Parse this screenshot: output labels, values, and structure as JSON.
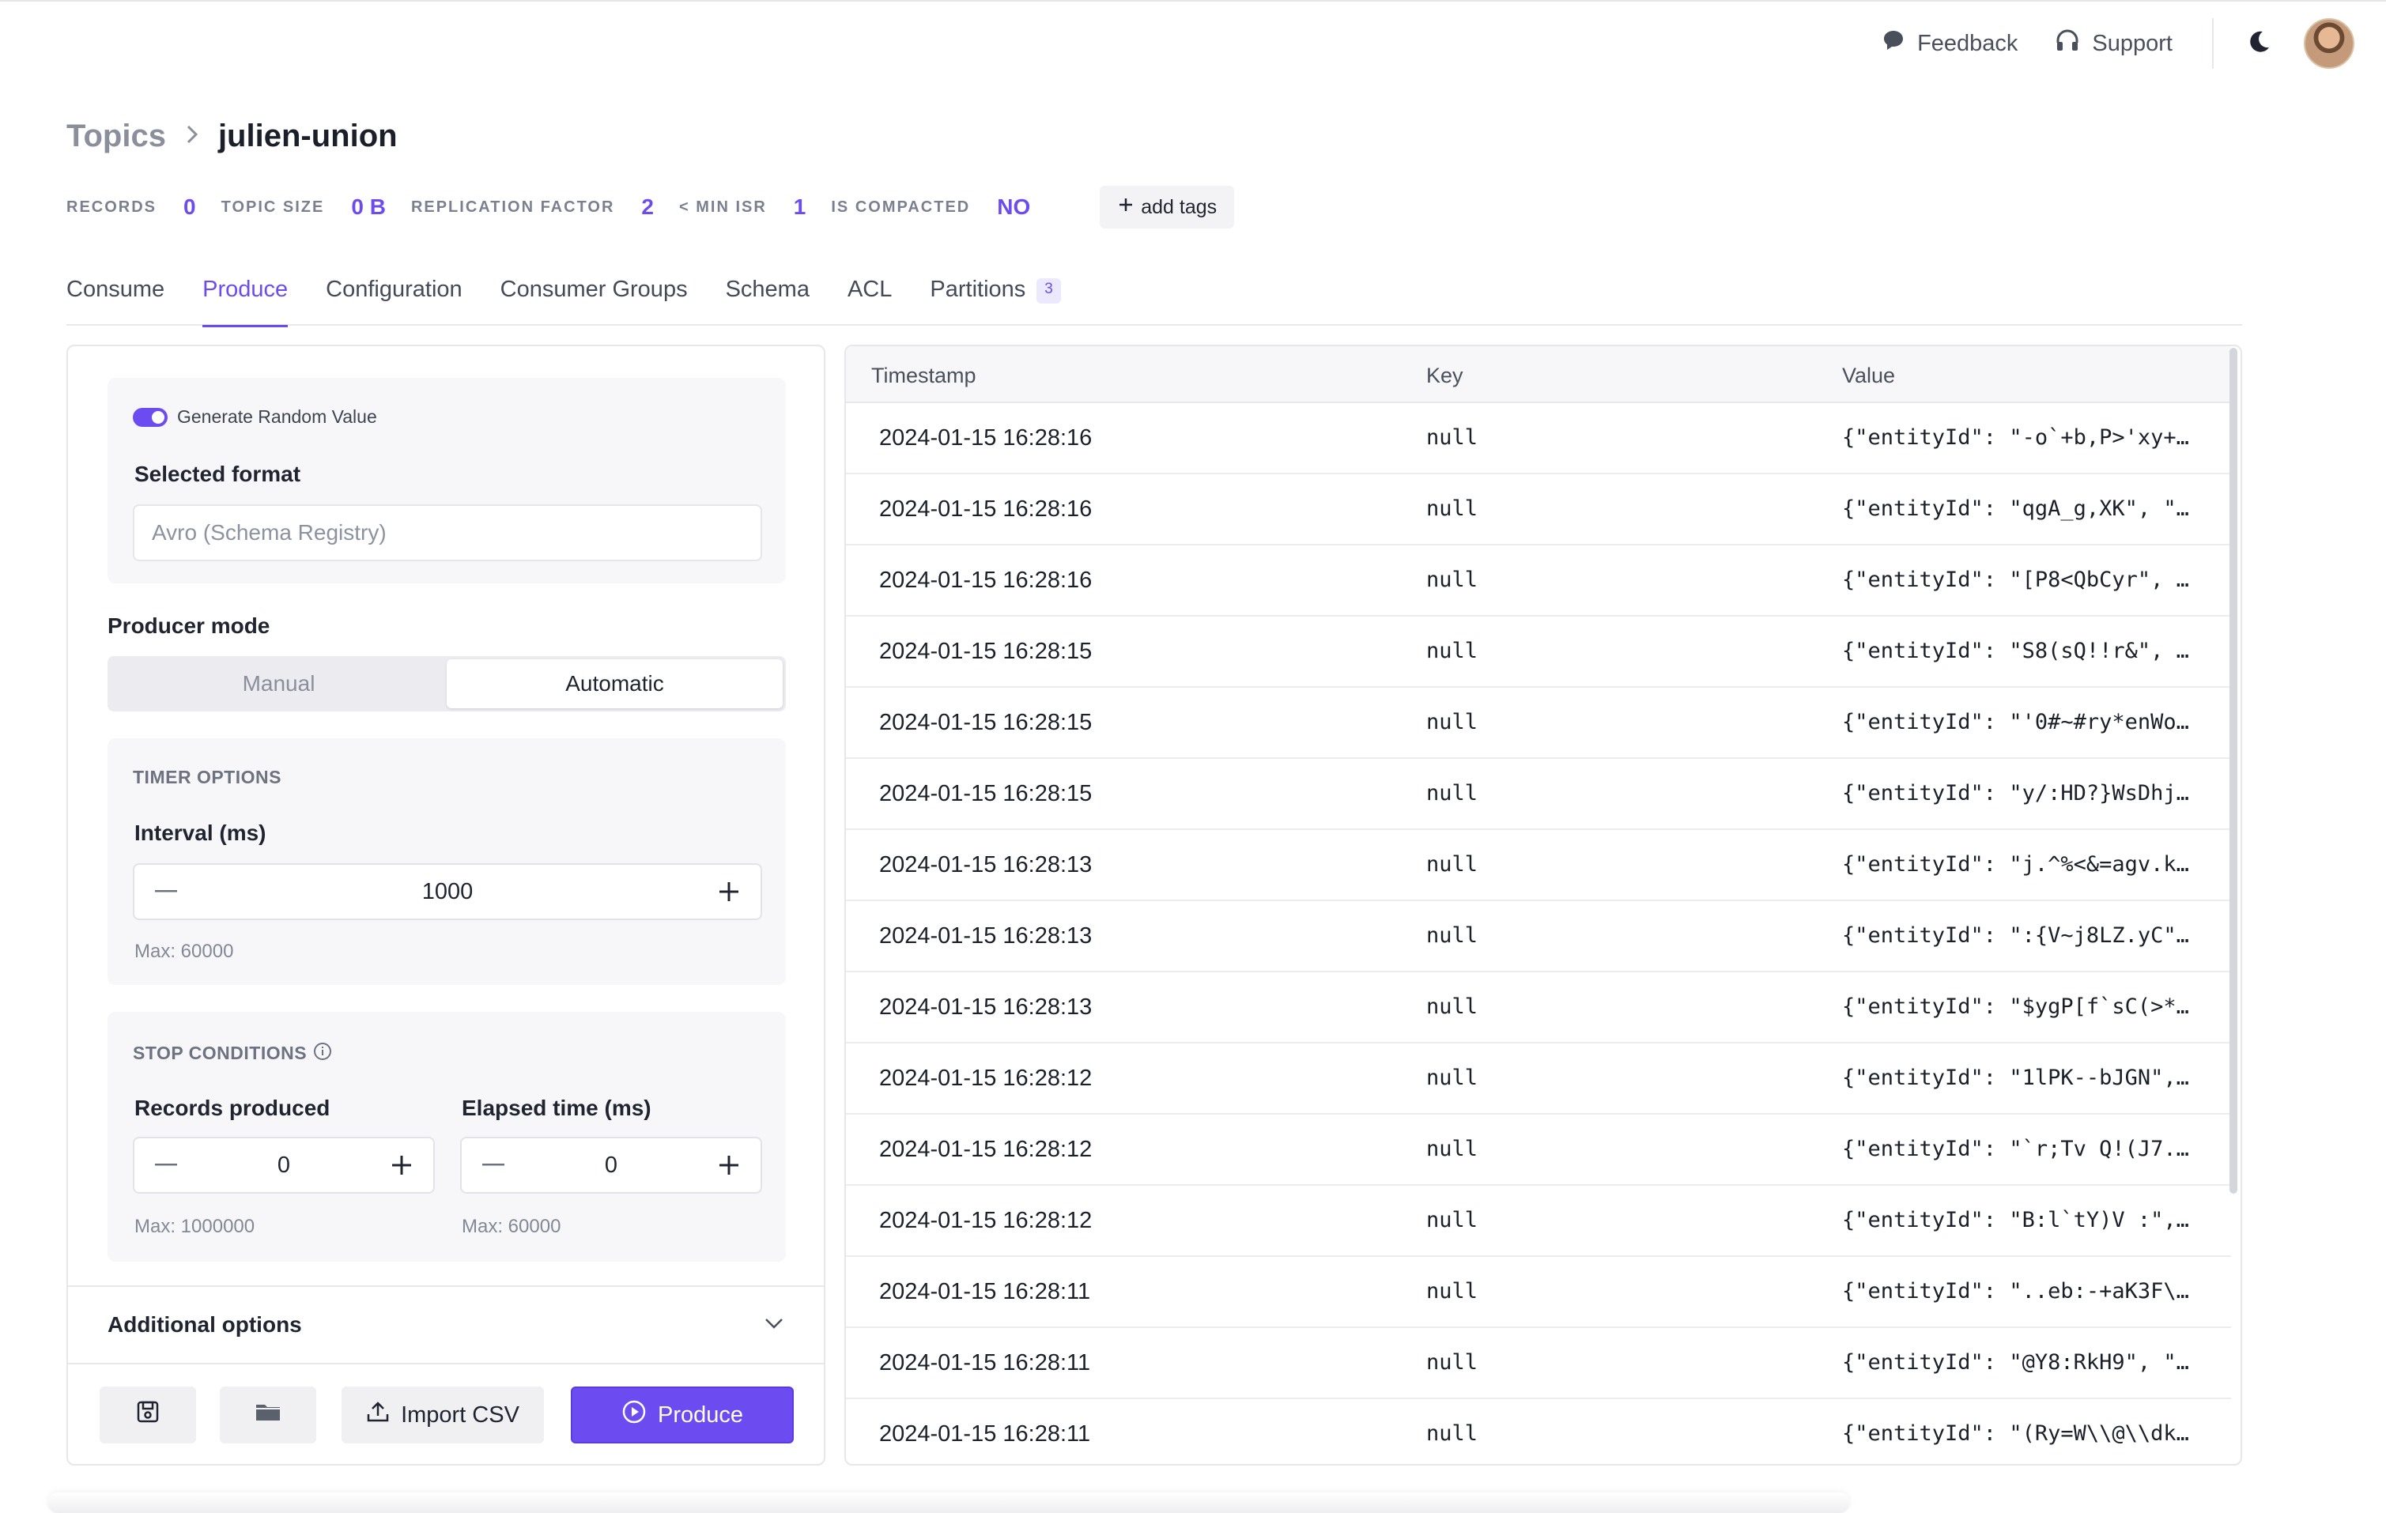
{
  "topbar": {
    "feedback_label": "Feedback",
    "support_label": "Support",
    "theme_icon": "moon-icon",
    "avatar_icon": "user-avatar"
  },
  "breadcrumb": {
    "root": "Topics",
    "current": "julien-union"
  },
  "stats": {
    "records_label": "RECORDS",
    "records_value": "0",
    "size_label": "TOPIC SIZE",
    "size_value": "0 B",
    "replication_label": "REPLICATION FACTOR",
    "replication_value": "2",
    "min_isr_label": "< MIN ISR",
    "min_isr_value": "1",
    "compacted_label": "IS COMPACTED",
    "compacted_value": "NO",
    "add_tags_label": "add tags"
  },
  "tabs": [
    {
      "label": "Consume"
    },
    {
      "label": "Produce"
    },
    {
      "label": "Configuration"
    },
    {
      "label": "Consumer Groups"
    },
    {
      "label": "Schema"
    },
    {
      "label": "ACL"
    },
    {
      "label": "Partitions",
      "badge": "3"
    }
  ],
  "active_tab": "Produce",
  "producer": {
    "generate_random_label": "Generate Random Value",
    "generate_random_on": true,
    "selected_format_label": "Selected format",
    "selected_format_value": "Avro (Schema Registry)",
    "mode_label": "Producer mode",
    "mode_options": [
      "Manual",
      "Automatic"
    ],
    "mode_selected": "Automatic",
    "timer_title": "TIMER OPTIONS",
    "interval_label": "Interval (ms)",
    "interval_value": "1000",
    "interval_max": "Max: 60000",
    "stop_title": "STOP CONDITIONS",
    "records_produced_label": "Records produced",
    "records_produced_value": "0",
    "records_produced_max": "Max: 1000000",
    "elapsed_label": "Elapsed time (ms)",
    "elapsed_value": "0",
    "elapsed_max": "Max: 60000",
    "additional_options_label": "Additional options",
    "import_csv_label": "Import CSV",
    "produce_label": "Produce"
  },
  "table": {
    "columns": [
      "Timestamp",
      "Key",
      "Value"
    ],
    "rows": [
      {
        "ts": "2024-01-15 16:28:16",
        "key": "null",
        "value": "{\"entityId\": \"-o`+b,P>'xy+…"
      },
      {
        "ts": "2024-01-15 16:28:16",
        "key": "null",
        "value": "{\"entityId\": \"qgA_g,XK\", \"…"
      },
      {
        "ts": "2024-01-15 16:28:16",
        "key": "null",
        "value": "{\"entityId\": \"[P8<QbCyr\", …"
      },
      {
        "ts": "2024-01-15 16:28:15",
        "key": "null",
        "value": "{\"entityId\": \"S8(sQ!!r&\", …"
      },
      {
        "ts": "2024-01-15 16:28:15",
        "key": "null",
        "value": "{\"entityId\": \"'0#~#ry*enWo…"
      },
      {
        "ts": "2024-01-15 16:28:15",
        "key": "null",
        "value": "{\"entityId\": \"y/:HD?}WsDhj…"
      },
      {
        "ts": "2024-01-15 16:28:13",
        "key": "null",
        "value": "{\"entityId\": \"j.^%<&=agv.k…"
      },
      {
        "ts": "2024-01-15 16:28:13",
        "key": "null",
        "value": "{\"entityId\": \":{V~j8LZ.yC\"…"
      },
      {
        "ts": "2024-01-15 16:28:13",
        "key": "null",
        "value": "{\"entityId\": \"$ygP[f`sC(>*…"
      },
      {
        "ts": "2024-01-15 16:28:12",
        "key": "null",
        "value": "{\"entityId\": \"1lPK--bJGN\",…"
      },
      {
        "ts": "2024-01-15 16:28:12",
        "key": "null",
        "value": "{\"entityId\": \"`r;Tv Q!(J7.…"
      },
      {
        "ts": "2024-01-15 16:28:12",
        "key": "null",
        "value": "{\"entityId\": \"B:l`tY)V :\",…"
      },
      {
        "ts": "2024-01-15 16:28:11",
        "key": "null",
        "value": "{\"entityId\": \"..eb:-+aK3F\\…"
      },
      {
        "ts": "2024-01-15 16:28:11",
        "key": "null",
        "value": "{\"entityId\": \"@Y8:RkH9\", \"…"
      },
      {
        "ts": "2024-01-15 16:28:11",
        "key": "null",
        "value": "{\"entityId\": \"(Ry=W\\\\@\\\\dk…"
      }
    ]
  },
  "colors": {
    "accent": "#6c4cf0",
    "text": "#1f2430",
    "muted": "#8a8f9b",
    "border": "#e6e7eb"
  }
}
